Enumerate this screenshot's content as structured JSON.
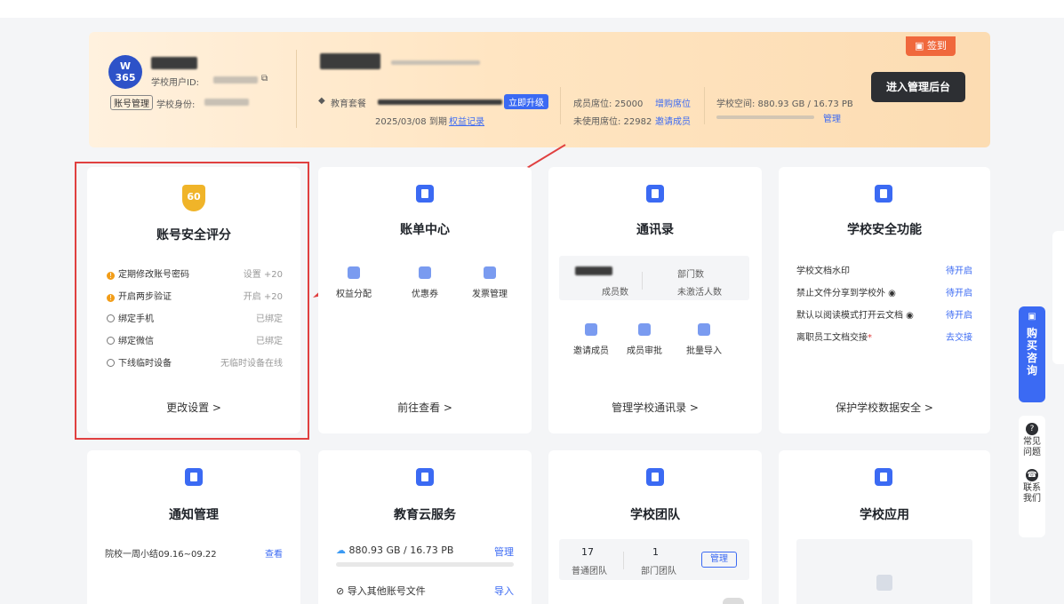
{
  "banner": {
    "logo_text": "365",
    "user_id_label": "学校用户ID:",
    "account_mgmt_label": "账号管理",
    "school_identity_label": "学校身份:",
    "edu_package_label": "教育套餐",
    "upgrade_label": "立即升级",
    "expiry": "2025/03/08 到期",
    "rights_record_label": "权益记录",
    "member_seats_label": "成员席位: 25000",
    "buy_seats_label": "增购席位",
    "unused_seats_label": "未使用席位: 22982",
    "invite_members_label": "邀请成员",
    "school_space_label": "学校空间: 880.93 GB / 16.73 PB",
    "manage_label": "管理",
    "enter_admin_label": "进入管理后台",
    "signin_label": "签到"
  },
  "security_card": {
    "score": "60",
    "title": "账号安全评分",
    "items": [
      {
        "label": "定期修改账号密码",
        "status": "设置 +20",
        "warn": true
      },
      {
        "label": "开启两步验证",
        "status": "开启 +20",
        "warn": true
      },
      {
        "label": "绑定手机",
        "status": "已绑定",
        "warn": false
      },
      {
        "label": "绑定微信",
        "status": "已绑定",
        "warn": false
      },
      {
        "label": "下线临时设备",
        "status": "无临时设备在线",
        "warn": false
      }
    ],
    "footer": "更改设置 >"
  },
  "billing_card": {
    "title": "账单中心",
    "actions": [
      "权益分配",
      "优惠券",
      "发票管理"
    ],
    "footer": "前往查看 >"
  },
  "contacts_card": {
    "title": "通讯录",
    "member_count_label": "成员数",
    "dept_count_label": "部门数",
    "inactive_label": "未激活人数",
    "actions": [
      "邀请成员",
      "成员审批",
      "批量导入"
    ],
    "footer": "管理学校通讯录 >"
  },
  "school_security_card": {
    "title": "学校安全功能",
    "items": [
      {
        "label": "学校文档水印",
        "action": "待开启"
      },
      {
        "label": "禁止文件分享到学校外",
        "action": "待开启"
      },
      {
        "label": "默认以阅读模式打开云文档",
        "action": "待开启"
      },
      {
        "label": "离职员工文档交接",
        "action": "去交接"
      }
    ],
    "footer": "保护学校数据安全 >"
  },
  "notify_card": {
    "title": "通知管理",
    "item": "院校一周小结09.16~09.22",
    "action": "查看"
  },
  "cloud_card": {
    "title": "教育云服务",
    "storage": "880.93 GB / 16.73 PB",
    "manage_label": "管理",
    "import_label": "导入其他账号文件",
    "import_action": "导入"
  },
  "team_card": {
    "title": "学校团队",
    "normal_count": "17",
    "normal_label": "普通团队",
    "dept_count": "1",
    "dept_label": "部门团队",
    "manage_label": "管理"
  },
  "apps_card": {
    "title": "学校应用"
  },
  "side": {
    "consult_label": "购买咨询",
    "faq_label": "常见问题",
    "contact_label": "联系我们"
  },
  "colors": {
    "accent": "#3b6af3",
    "warning": "#f29d18",
    "highlight_box": "#e04040",
    "signin": "#f0683c"
  }
}
